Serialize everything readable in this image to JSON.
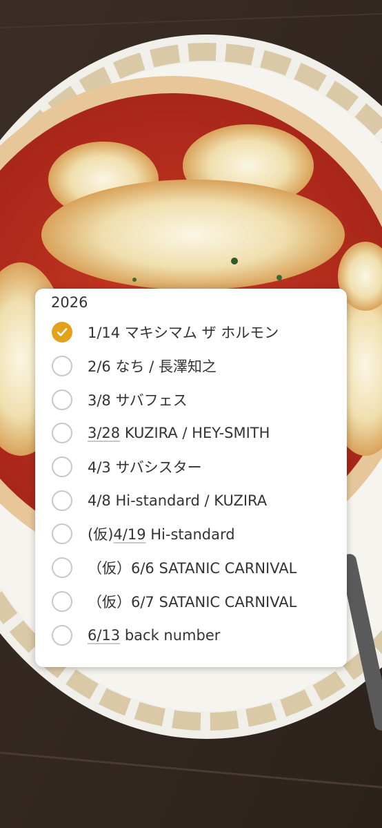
{
  "note": {
    "year": "2026",
    "items": [
      {
        "checked": true,
        "pre": "",
        "date": "1/14",
        "date_underlined": false,
        "rest": " マキシマム ザ ホルモン"
      },
      {
        "checked": false,
        "pre": "",
        "date": "2/6",
        "date_underlined": false,
        "rest": " なち / 長澤知之"
      },
      {
        "checked": false,
        "pre": "",
        "date": "3/8",
        "date_underlined": false,
        "rest": " サバフェス"
      },
      {
        "checked": false,
        "pre": "",
        "date": "3/28",
        "date_underlined": true,
        "rest": " KUZIRA / HEY-SMITH"
      },
      {
        "checked": false,
        "pre": "",
        "date": "4/3",
        "date_underlined": false,
        "rest": " サバシスター"
      },
      {
        "checked": false,
        "pre": "",
        "date": "4/8",
        "date_underlined": false,
        "rest": " Hi-standard / KUZIRA"
      },
      {
        "checked": false,
        "pre": "(仮)",
        "date": "4/19",
        "date_underlined": true,
        "rest": " Hi-standard"
      },
      {
        "checked": false,
        "pre": "（仮）",
        "date": "6/6",
        "date_underlined": false,
        "rest": " SATANIC CARNIVAL"
      },
      {
        "checked": false,
        "pre": "（仮）",
        "date": "6/7",
        "date_underlined": false,
        "rest": " SATANIC CARNIVAL"
      },
      {
        "checked": false,
        "pre": "",
        "date": "6/13",
        "date_underlined": true,
        "rest": " back number"
      }
    ]
  },
  "colors": {
    "check_accent": "#e3a21a",
    "text": "#333333",
    "card": "#ffffff"
  },
  "background_photo": "pizza-margherita-on-plate"
}
